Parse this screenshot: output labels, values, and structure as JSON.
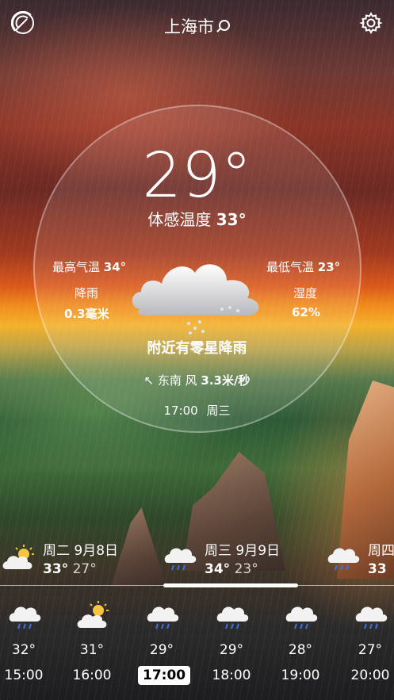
{
  "header": {
    "city": "上海市"
  },
  "current": {
    "temperature": "29°",
    "feels_label": "体感温度",
    "feels_value": "33°",
    "high_label": "最高气温",
    "high_value": "34°",
    "low_label": "最低气温",
    "low_value": "23°",
    "rain_label": "降雨",
    "rain_value": "0.3毫米",
    "humidity_label": "湿度",
    "humidity_value": "62%",
    "description": "附近有零星降雨",
    "wind_arrow": "↖",
    "wind_text": "东南 风",
    "wind_value": "3.3米/秒",
    "time": "17:00",
    "weekday": "周三"
  },
  "daily": [
    {
      "date": "周二 9月8日",
      "high": "33°",
      "low": "27°",
      "icon": "partly-sunny-cloud-icon"
    },
    {
      "date": "周三 9月9日",
      "high": "34°",
      "low": "23°",
      "icon": "rain-cloud-icon"
    },
    {
      "date": "周四",
      "high": "33",
      "low": "",
      "icon": "rain-cloud-icon"
    }
  ],
  "hourly": [
    {
      "hour": "15:00",
      "temp": "32°",
      "icon": "rain-cloud-icon"
    },
    {
      "hour": "16:00",
      "temp": "31°",
      "icon": "partly-sunny-cloud-icon"
    },
    {
      "hour": "17:00",
      "temp": "29°",
      "icon": "rain-cloud-icon",
      "selected": true
    },
    {
      "hour": "18:00",
      "temp": "29°",
      "icon": "rain-cloud-icon"
    },
    {
      "hour": "19:00",
      "temp": "28°",
      "icon": "rain-cloud-icon"
    },
    {
      "hour": "20:00",
      "temp": "27°",
      "icon": "rain-cloud-icon"
    }
  ],
  "colors": {
    "rain_drop": "#3a6fd8",
    "sun": "#f5c542",
    "cloud": "#f2f2f2"
  }
}
